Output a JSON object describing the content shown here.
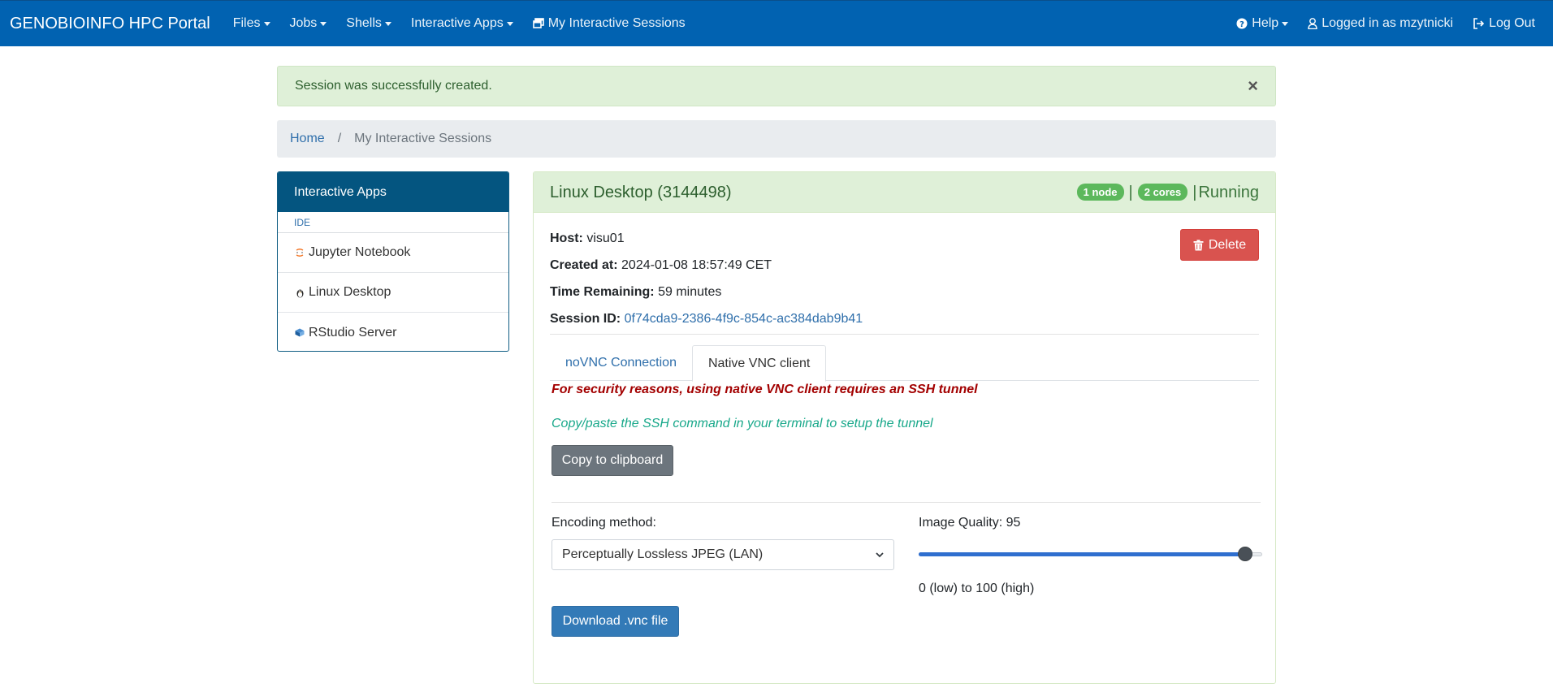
{
  "navbar": {
    "brand": "GENOBIOINFO HPC Portal",
    "menus": [
      "Files",
      "Jobs",
      "Shells",
      "Interactive Apps"
    ],
    "sessions_link": "My Interactive Sessions",
    "help": "Help",
    "user": "Logged in as mzytnicki",
    "logout": "Log Out"
  },
  "alert": {
    "message": "Session was successfully created.",
    "close": "×"
  },
  "breadcrumb": {
    "home": "Home",
    "separator": "/",
    "current": "My Interactive Sessions"
  },
  "sidebar": {
    "title": "Interactive Apps",
    "group": "IDE",
    "items": [
      {
        "label": "Jupyter Notebook",
        "icon": "jupyter-icon"
      },
      {
        "label": "Linux Desktop",
        "icon": "linux-penguin-icon"
      },
      {
        "label": "RStudio Server",
        "icon": "rstudio-icon"
      }
    ]
  },
  "session": {
    "title": "Linux Desktop (3144498)",
    "nodes_badge": "1 node",
    "cores_badge": "2 cores",
    "separator": "|",
    "status": "Running",
    "host_label": "Host:",
    "host": "visu01",
    "created_label": "Created at:",
    "created": "2024-01-08 18:57:49 CET",
    "remaining_label": "Time Remaining:",
    "remaining": "59 minutes",
    "id_label": "Session ID:",
    "id": "0f74cda9-2386-4f9c-854c-ac384dab9b41",
    "delete_label": "Delete",
    "tabs": [
      "noVNC Connection",
      "Native VNC client"
    ],
    "warning": "For security reasons, using native VNC client requires an SSH tunnel",
    "hint": "Copy/paste the SSH command in your terminal to setup the tunnel",
    "copy_label": "Copy to clipboard",
    "encoding_label": "Encoding method:",
    "encoding_value": "Perceptually Lossless JPEG (LAN)",
    "quality_label": "Image Quality: 95",
    "quality_value": 95,
    "quality_max": 100,
    "quality_range": "0 (low) to 100 (high)",
    "download_label": "Download .vnc file"
  },
  "colors": {
    "navbar": "#0162b1",
    "sidebar_head": "#045580",
    "success_bg": "#dff0d8",
    "badge": "#5cb85c",
    "danger": "#d9534f",
    "warning_text": "#a30000",
    "hint_text": "#18a88a",
    "primary": "#337ab7"
  }
}
